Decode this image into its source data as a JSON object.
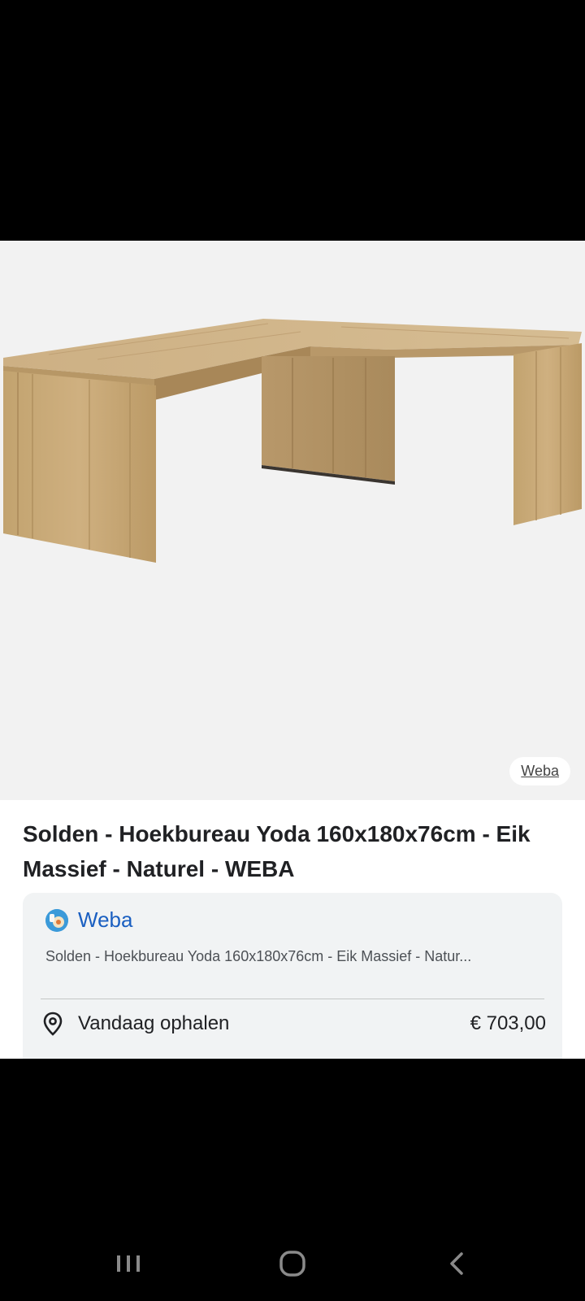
{
  "image": {
    "source_label": "Weba"
  },
  "product": {
    "title": "Solden - Hoekbureau Yoda 160x180x76cm - Eik Massief - Naturel - WEBA"
  },
  "merchant": {
    "name": "Weba",
    "description": "Solden - Hoekbureau Yoda 160x180x76cm - Eik Massief - Natur...",
    "pickup_label": "Vandaag ophalen",
    "price": "€ 703,00"
  },
  "navbar": {
    "recents_icon": "recents-icon",
    "home_icon": "home-icon",
    "back_icon": "back-icon"
  },
  "colors": {
    "link": "#1a5fc1",
    "card_bg": "#f1f3f4",
    "wood": "#c9a978"
  }
}
